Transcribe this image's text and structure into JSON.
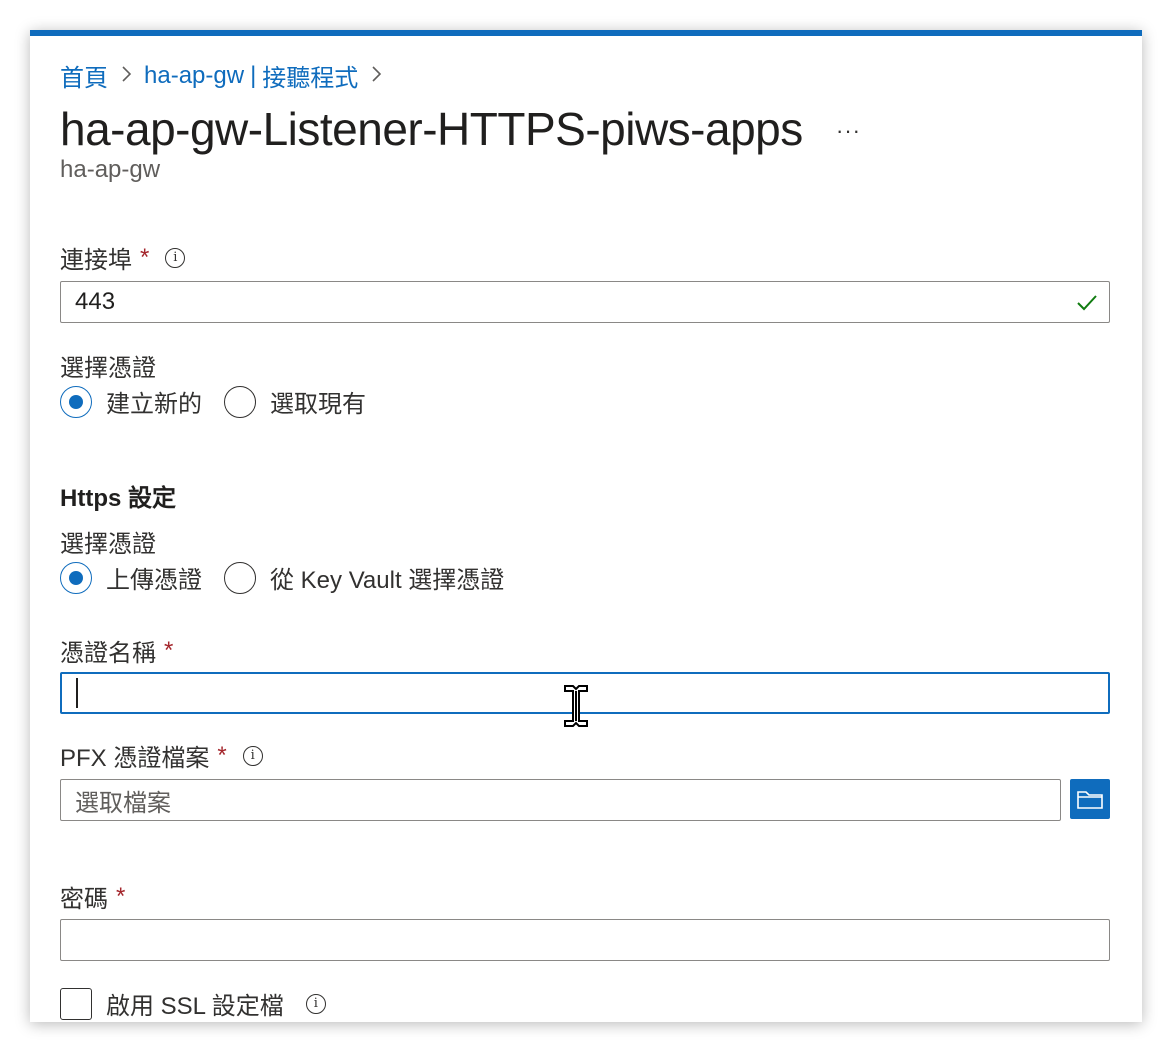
{
  "breadcrumb": {
    "home": "首頁",
    "resource": "ha-ap-gw",
    "separator": "|",
    "section": "接聽程式"
  },
  "header": {
    "title": "ha-ap-gw-Listener-HTTPS-piws-apps",
    "more_label": "···",
    "subtitle": "ha-ap-gw"
  },
  "port": {
    "label": "連接埠",
    "required_mark": "*",
    "value": "443"
  },
  "certificate_choice": {
    "label": "選擇憑證",
    "options": [
      "建立新的",
      "選取現有"
    ],
    "selected": "建立新的"
  },
  "https_settings": {
    "heading": "Https 設定",
    "choice_label": "選擇憑證",
    "options": [
      "上傳憑證",
      "從 Key Vault 選擇憑證"
    ],
    "selected": "上傳憑證"
  },
  "cert_name": {
    "label": "憑證名稱",
    "required_mark": "*",
    "value": ""
  },
  "pfx_file": {
    "label": "PFX 憑證檔案",
    "required_mark": "*",
    "placeholder": "選取檔案"
  },
  "password": {
    "label": "密碼",
    "required_mark": "*",
    "value": ""
  },
  "ssl_profile": {
    "label": "啟用 SSL 設定檔",
    "checked": false
  },
  "colors": {
    "accent": "#0f6cbd",
    "required": "#a4262c",
    "success": "#107c10"
  }
}
